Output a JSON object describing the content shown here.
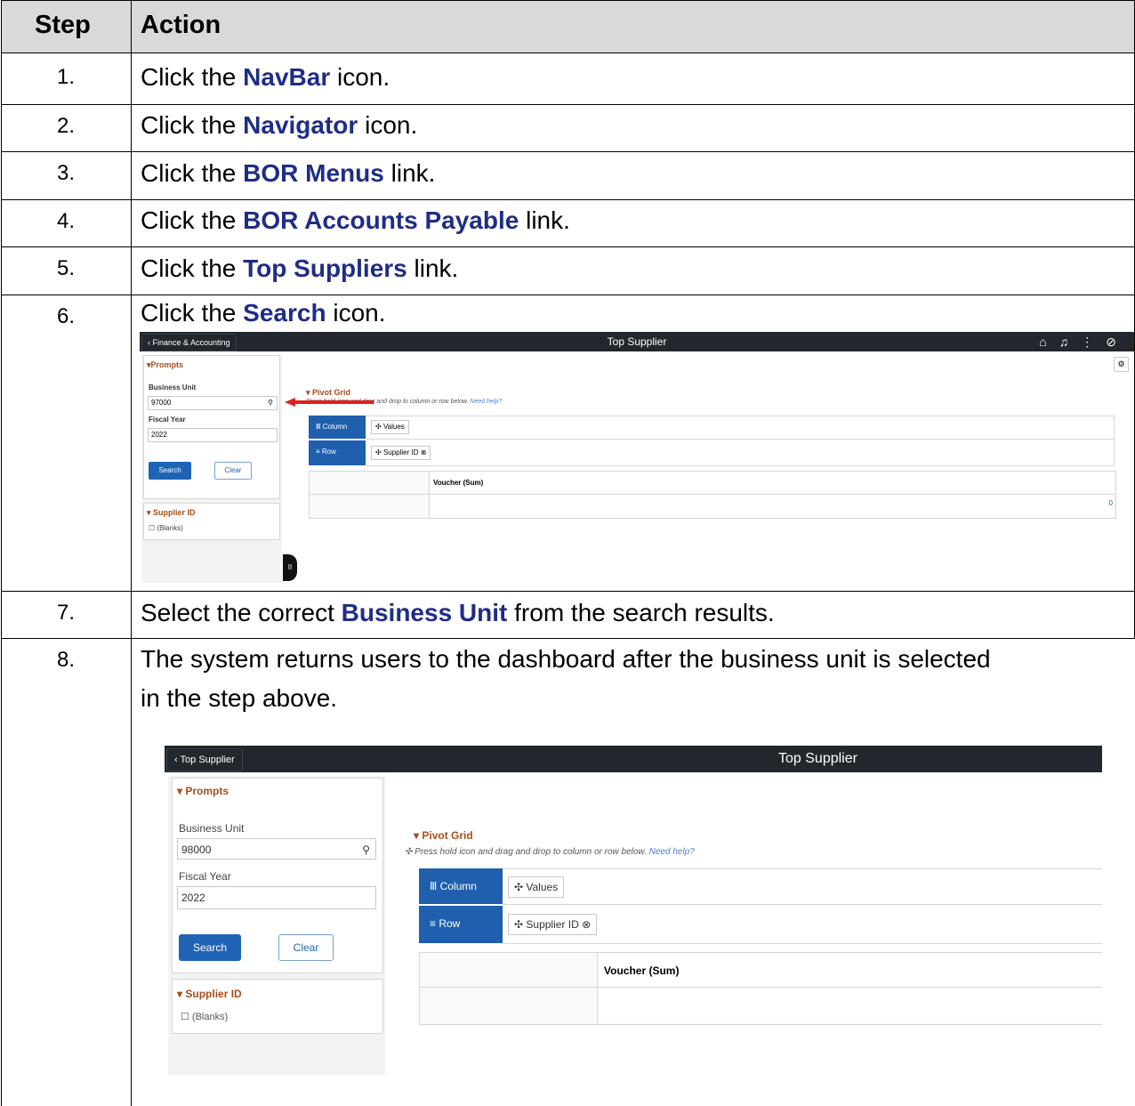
{
  "table": {
    "headers": {
      "step": "Step",
      "action": "Action"
    },
    "rows": [
      {
        "num": "1.",
        "pre": "Click the ",
        "bold": "NavBar",
        "post": " icon."
      },
      {
        "num": "2.",
        "pre": "Click the ",
        "bold": "Navigator",
        "post": " icon."
      },
      {
        "num": "3.",
        "pre": "Click the ",
        "bold": "BOR Menus",
        "post": " link."
      },
      {
        "num": "4.",
        "pre": "Click the ",
        "bold": "BOR Accounts Payable",
        "post": " link."
      },
      {
        "num": "5.",
        "pre": "Click the ",
        "bold": "Top Suppliers",
        "post": " link."
      },
      {
        "num": "6.",
        "pre": "Click the ",
        "bold": "Search",
        "post": " icon."
      },
      {
        "num": "7.",
        "pre": "Select the correct ",
        "bold": "Business Unit",
        "post": " from the search results."
      },
      {
        "num": "8.",
        "line1": "The system returns users to the dashboard after the business unit is selected",
        "line2": "in the step above."
      }
    ]
  },
  "screenshot1": {
    "back_label": "Finance & Accounting",
    "title": "Top Supplier",
    "prompts_title": "Prompts",
    "business_unit_label": "Business Unit",
    "business_unit_value": "97000",
    "fiscal_year_label": "Fiscal Year",
    "fiscal_year_value": "2022",
    "search_label": "Search",
    "clear_label": "Clear",
    "supplier_title": "Supplier ID",
    "blanks_label": "(Blanks)",
    "pivot_title": "Pivot Grid",
    "hint_text": "Press hold icon and drag and drop to column or row below.",
    "help_link": "Need help?",
    "column_label": "Column",
    "values_chip": "Values",
    "row_label": "Row",
    "supplier_chip": "Supplier ID",
    "voucher_header": "Voucher (Sum)",
    "voucher_value": "0"
  },
  "screenshot2": {
    "back_label": "Top Supplier",
    "title": "Top Supplier",
    "prompts_title": "Prompts",
    "business_unit_label": "Business Unit",
    "business_unit_value": "98000",
    "fiscal_year_label": "Fiscal Year",
    "fiscal_year_value": "2022",
    "search_label": "Search",
    "clear_label": "Clear",
    "supplier_title": "Supplier ID",
    "blanks_label": "(Blanks)",
    "pivot_title": "Pivot Grid",
    "hint_text": "Press hold icon and drag and drop to column or row below.",
    "help_link": "Need help?",
    "column_label": "Column",
    "values_chip": "Values",
    "row_label": "Row",
    "supplier_chip": "Supplier ID",
    "voucher_header": "Voucher (Sum)"
  },
  "colors": {
    "link_blue": "#1f2d86",
    "header_gray": "#d9d9d9",
    "accent_orange": "#a64e1b",
    "ps_blue": "#1f5fae",
    "arrow_red": "#e0201b"
  }
}
